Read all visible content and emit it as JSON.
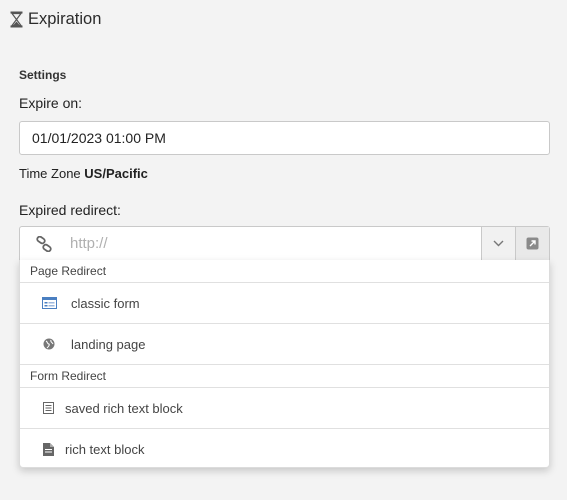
{
  "header": {
    "title": "Expiration",
    "icon": "hourglass-icon"
  },
  "settings": {
    "section_label": "Settings",
    "expire_label": "Expire on:",
    "expire_value": "01/01/2023 01:00 PM",
    "timezone_label": "Time Zone",
    "timezone_value": "US/Pacific",
    "redirect_label": "Expired redirect:",
    "redirect_placeholder": "http://",
    "redirect_value": ""
  },
  "dropdown": {
    "groups": [
      {
        "label": "Page Redirect",
        "options": [
          {
            "label": "classic form",
            "icon": "form-icon"
          },
          {
            "label": "landing page",
            "icon": "globe-icon"
          }
        ]
      },
      {
        "label": "Form Redirect",
        "options": [
          {
            "label": "saved rich text block",
            "icon": "document-lines-icon"
          },
          {
            "label": "rich text block",
            "icon": "document-icon"
          }
        ]
      }
    ]
  },
  "colors": {
    "background": "#f3f3f3",
    "input_border": "#c9c9c9",
    "form_icon_blue": "#4a7fc1"
  }
}
